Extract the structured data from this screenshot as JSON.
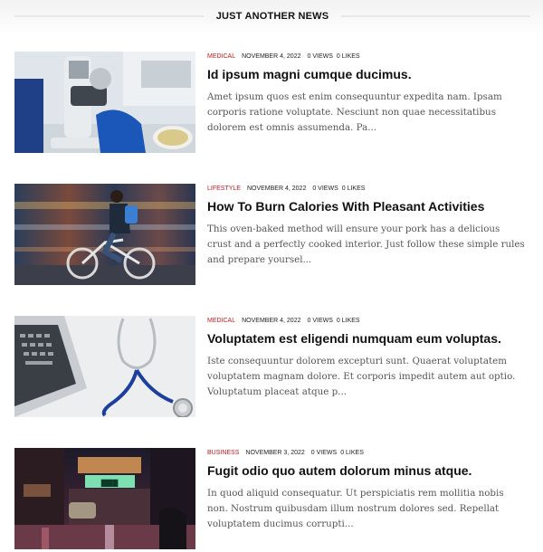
{
  "section": {
    "title": "JUST ANOTHER NEWS"
  },
  "posts": [
    {
      "category": "MEDICAL",
      "date": "NOVEMBER 4, 2022",
      "views": "0 VIEWS",
      "likes": "0 LIKES",
      "title": "Id ipsum magni cumque ducimus.",
      "excerpt": "Amet ipsum quos est enim consequuntur expedita nam. Ipsam corporis ratione voluptate. Nesciunt non quae necessitatibus dolorem est omnis assumenda. Pa...",
      "thumbnail": "microscope-image"
    },
    {
      "category": "LIFESTYLE",
      "date": "NOVEMBER 4, 2022",
      "views": "0 VIEWS",
      "likes": "0 LIKES",
      "title": "How To Burn Calories With Pleasant Activities",
      "excerpt": "This oven-baked method will ensure your pork has a delicious crust and a perfectly cooked interior. Just follow these simple rules and prepare yoursel...",
      "thumbnail": "cyclist-image"
    },
    {
      "category": "MEDICAL",
      "date": "NOVEMBER 4, 2022",
      "views": "0 VIEWS",
      "likes": "0 LIKES",
      "title": "Voluptatem est eligendi numquam eum voluptas.",
      "excerpt": "Iste consequuntur dolorem excepturi sunt. Quaerat voluptatem voluptatem magnam dolore. Et corporis impedit autem aut optio. Voluptatum placeat atque p...",
      "thumbnail": "stethoscope-laptop-image"
    },
    {
      "category": "BUSINESS",
      "date": "NOVEMBER 3, 2022",
      "views": "0 VIEWS",
      "likes": "0 LIKES",
      "title": "Fugit odio quo autem dolorum minus atque.",
      "excerpt": "In quod aliquid consequatur. Ut perspiciatis rem mollitia nobis non. Nostrum quibusdam illum nostrum dolores sed. Repellat voluptatem ducimus corrupti...",
      "thumbnail": "night-street-image"
    }
  ],
  "colors": {
    "category": "#c4161c",
    "title": "#111111",
    "excerpt": "#555555",
    "divider": "#e8e8e8"
  }
}
